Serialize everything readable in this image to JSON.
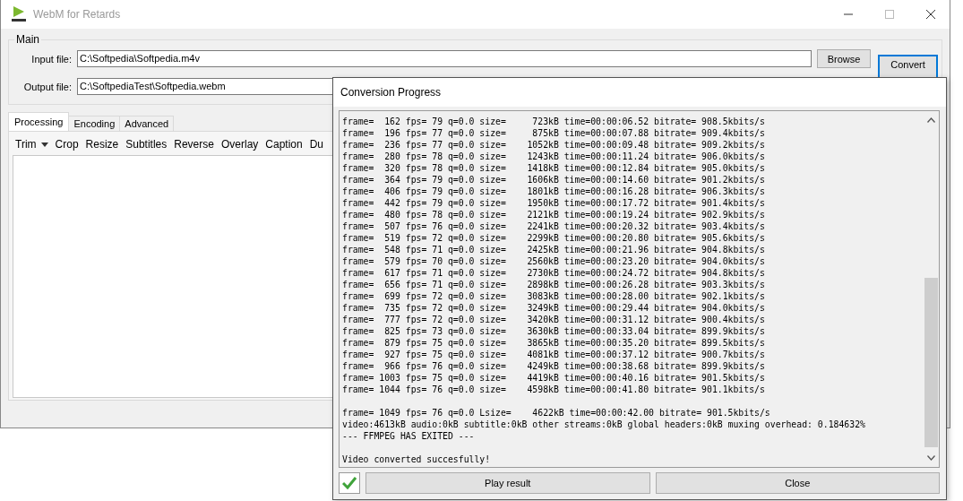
{
  "window": {
    "title": "WebM for Retards"
  },
  "main_group": {
    "title": "Main",
    "fields": [
      {
        "label": "Input file:",
        "value": "C:\\Softpedia\\Softpedia.m4v"
      },
      {
        "label": "Output file:",
        "value": "C:\\SoftpediaTest\\Softpedia.webm"
      }
    ],
    "browse_button": "Browse",
    "convert_button": "Convert"
  },
  "tabs": [
    {
      "label": "Processing",
      "selected": true
    },
    {
      "label": "Encoding",
      "selected": false
    },
    {
      "label": "Advanced",
      "selected": false
    }
  ],
  "toolbar": [
    {
      "label": "Trim",
      "kind": "dropdown"
    },
    {
      "label": "Crop",
      "kind": "button"
    },
    {
      "label": "Resize",
      "kind": "button"
    },
    {
      "label": "Subtitles",
      "kind": "button"
    },
    {
      "label": "Reverse",
      "kind": "button"
    },
    {
      "label": "Overlay",
      "kind": "button"
    },
    {
      "label": "Caption",
      "kind": "button"
    },
    {
      "label": "Du",
      "kind": "button"
    }
  ],
  "dialog": {
    "title": "Conversion Progress",
    "log": [
      [
        "frame=  162 fps= 79 q=0.0 size=     723kB time=00:00:06.52 bitrate= 908.5kbits/s",
        "frame=  196 fps= 77 q=0.0 size=     875kB time=00:00:07.88 bitrate= 909.4kbits/s",
        "frame=  236 fps= 77 q=0.0 size=    1052kB time=00:00:09.48 bitrate= 909.2kbits/s",
        "frame=  280 fps= 78 q=0.0 size=    1243kB time=00:00:11.24 bitrate= 906.0kbits/s",
        "frame=  320 fps= 78 q=0.0 size=    1418kB time=00:00:12.84 bitrate= 905.0kbits/s",
        "frame=  364 fps= 79 q=0.0 size=    1606kB time=00:00:14.60 bitrate= 901.2kbits/s",
        "frame=  406 fps= 79 q=0.0 size=    1801kB time=00:00:16.28 bitrate= 906.3kbits/s",
        "frame=  442 fps= 79 q=0.0 size=    1950kB time=00:00:17.72 bitrate= 901.4kbits/s",
        "frame=  480 fps= 78 q=0.0 size=    2121kB time=00:00:19.24 bitrate= 902.9kbits/s",
        "frame=  507 fps= 76 q=0.0 size=    2241kB time=00:00:20.32 bitrate= 903.4kbits/s",
        "frame=  519 fps= 72 q=0.0 size=    2299kB time=00:00:20.80 bitrate= 905.6kbits/s",
        "frame=  548 fps= 71 q=0.0 size=    2425kB time=00:00:21.96 bitrate= 904.8kbits/s",
        "frame=  579 fps= 70 q=0.0 size=    2560kB time=00:00:23.20 bitrate= 904.0kbits/s",
        "frame=  617 fps= 71 q=0.0 size=    2730kB time=00:00:24.72 bitrate= 904.8kbits/s",
        "frame=  656 fps= 71 q=0.0 size=    2898kB time=00:00:26.28 bitrate= 903.3kbits/s",
        "frame=  699 fps= 72 q=0.0 size=    3083kB time=00:00:28.00 bitrate= 902.1kbits/s",
        "frame=  735 fps= 72 q=0.0 size=    3249kB time=00:00:29.44 bitrate= 904.0kbits/s",
        "frame=  777 fps= 72 q=0.0 size=    3420kB time=00:00:31.12 bitrate= 900.4kbits/s",
        "frame=  825 fps= 73 q=0.0 size=    3630kB time=00:00:33.04 bitrate= 899.9kbits/s",
        "frame=  879 fps= 75 q=0.0 size=    3865kB time=00:00:35.20 bitrate= 899.5kbits/s",
        "frame=  927 fps= 75 q=0.0 size=    4081kB time=00:00:37.12 bitrate= 900.7kbits/s",
        "frame=  966 fps= 76 q=0.0 size=    4249kB time=00:00:38.68 bitrate= 899.9kbits/s",
        "frame= 1003 fps= 75 q=0.0 size=    4419kB time=00:00:40.16 bitrate= 901.5kbits/s",
        "frame= 1044 fps= 76 q=0.0 size=    4598kB time=00:00:41.80 bitrate= 901.1kbits/s"
      ],
      [
        "frame= 1049 fps= 76 q=0.0 Lsize=    4622kB time=00:00:42.00 bitrate= 901.5kbits/s",
        "video:4613kB audio:0kB subtitle:0kB other streams:0kB global headers:0kB muxing overhead: 0.184632%",
        "--- FFMPEG HAS EXITED ---"
      ],
      [
        "Video converted succesfully!"
      ]
    ],
    "success": true,
    "buttons": [
      "Play result",
      "Close"
    ]
  }
}
